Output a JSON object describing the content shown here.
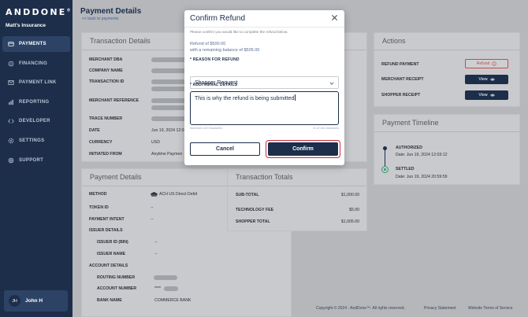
{
  "sidebar": {
    "logo": "ANDDONE",
    "logo_mark": "®",
    "org": "Matt's Insurance",
    "items": [
      {
        "label": "PAYMENTS",
        "icon": "payments-icon"
      },
      {
        "label": "FINANCING",
        "icon": "financing-icon"
      },
      {
        "label": "PAYMENT LINK",
        "icon": "payment-link-icon"
      },
      {
        "label": "REPORTING",
        "icon": "reporting-icon"
      },
      {
        "label": "DEVELOPER",
        "icon": "developer-icon"
      },
      {
        "label": "SETTINGS",
        "icon": "settings-icon"
      },
      {
        "label": "SUPPORT",
        "icon": "support-icon"
      }
    ],
    "user": {
      "initials": "JH",
      "name": "John H"
    }
  },
  "header": {
    "title": "Payment Details",
    "back": "<< back to payments"
  },
  "transaction_details": {
    "title": "Transaction Details",
    "rows": [
      {
        "label": "MERCHANT DBA",
        "value": ""
      },
      {
        "label": "COMPANY NAME",
        "value": ""
      },
      {
        "label": "TRANSACTION ID",
        "value": ""
      },
      {
        "label": "MERCHANT REFERENCE",
        "value": ""
      },
      {
        "label": "TRACE NUMBER",
        "value": ""
      },
      {
        "label": "DATE",
        "value": "Jun 19, 2024 12:03"
      },
      {
        "label": "CURRENCY",
        "value": "USD"
      },
      {
        "label": "INITIATED FROM",
        "value": "Anytime Paymen"
      }
    ]
  },
  "actions": {
    "title": "Actions",
    "refund_label": "REFUND PAYMENT",
    "refund_button": "Refund",
    "receipt_label": "MERCHANT RECEIPT",
    "receipt_button": "View",
    "shopper_label": "SHOPPER RECEIPT",
    "shopper_button": "View"
  },
  "timeline": {
    "title": "Payment Timeline",
    "events": [
      {
        "status": "AUTHORIZED",
        "date": "Date: Jun 19, 2024 12:03:12"
      },
      {
        "status": "SETTLED",
        "date": "Date: Jun 19, 2024 20:59:59"
      }
    ]
  },
  "payment_details": {
    "title": "Payment Details",
    "method_label": "METHOD",
    "method_value": "ACH US Direct Debit",
    "rows": [
      {
        "label": "TOKEN ID",
        "value": "--"
      },
      {
        "label": "PAYMENT INTENT",
        "value": "--"
      },
      {
        "label": "ISSUER DETAILS",
        "value": ""
      },
      {
        "label": "ISSUER ID (BIN)",
        "value": "--"
      },
      {
        "label": "ISSUER NAME",
        "value": "--"
      },
      {
        "label": "ACCOUNT DETAILS",
        "value": ""
      },
      {
        "label": "ROUTING NUMBER",
        "value": ""
      },
      {
        "label": "ACCOUNT NUMBER",
        "value": "****"
      },
      {
        "label": "BANK NAME",
        "value": "COMMERCE BANK"
      }
    ]
  },
  "totals": {
    "title": "Transaction Totals",
    "rows": [
      {
        "label": "SUB-TOTAL",
        "value": "$1,000.00"
      },
      {
        "label": "TECHNOLOGY FEE",
        "value": "$5.00"
      },
      {
        "label": "SHOPPER TOTAL",
        "value": "$1,005.00"
      }
    ]
  },
  "footer": {
    "copyright": "Copyright © 2024 - AndDone™. All rights reserved.",
    "privacy": "Privacy Statement",
    "terms": "Website Terms of Service"
  },
  "modal": {
    "title": "Confirm Refund",
    "subtitle": "Please confirm you would like to complete the refund below.",
    "refund_amount": "Refund of $500.00",
    "remaining": "with a remaining balance of $505.00",
    "reason_label": "* REASON FOR REFUND",
    "reason_value": "Shopper Request",
    "details_label": "* ADDITIONAL DETAILS",
    "details_value": "This is why the refund is being submitted",
    "hint_left": "Maximum 140 Characters",
    "hint_right": "41 of 140 characters",
    "cancel": "Cancel",
    "confirm": "Confirm"
  },
  "colors": {
    "navy": "#1c2e4a",
    "danger": "#c72b3b",
    "success": "#2f9a6b"
  }
}
